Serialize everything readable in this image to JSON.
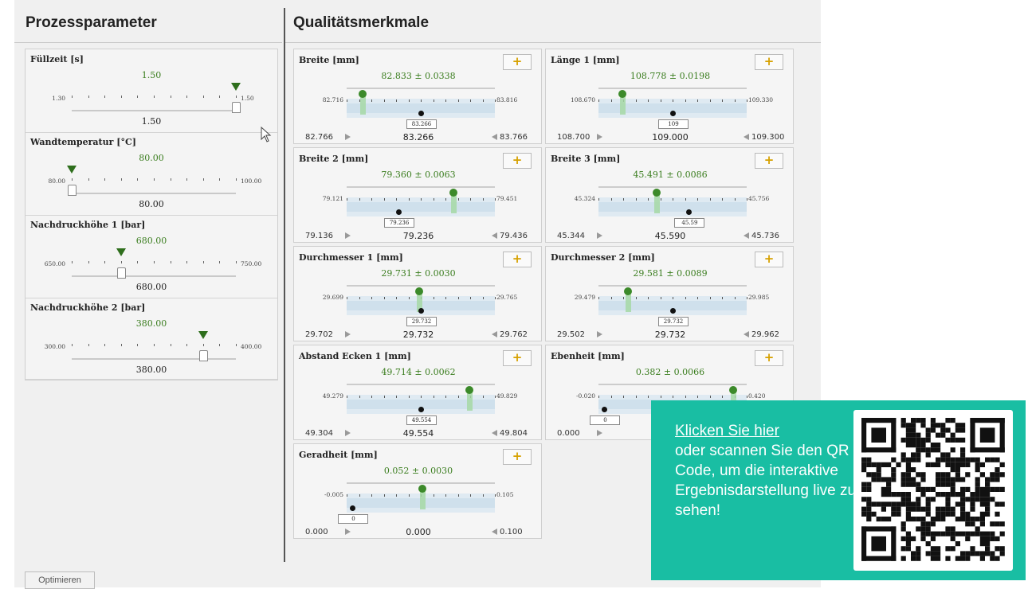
{
  "left_title": "Prozessparameter",
  "right_title": "Qualitätsmerkmale",
  "params": [
    {
      "label": "Füllzeit [s]",
      "value": "1.50",
      "min": "1.30",
      "max": "1.50",
      "current": "1.50",
      "fraction": 1.0
    },
    {
      "label": "Wandtemperatur [°C]",
      "value": "80.00",
      "min": "80.00",
      "max": "100.00",
      "current": "80.00",
      "fraction": 0.0
    },
    {
      "label": "Nachdruckhöhe 1 [bar]",
      "value": "680.00",
      "min": "650.00",
      "max": "750.00",
      "current": "680.00",
      "fraction": 0.3
    },
    {
      "label": "Nachdruckhöhe 2 [bar]",
      "value": "380.00",
      "min": "300.00",
      "max": "400.00",
      "current": "380.00",
      "fraction": 0.8
    }
  ],
  "qualities": [
    {
      "label": "Breite [mm]",
      "mean": "82.833 ± 0.0338",
      "axis_min": "82.716",
      "axis_max": "83.816",
      "box": "83.266",
      "low": "82.766",
      "center": "83.266",
      "high": "83.766",
      "green_frac": 0.11,
      "black_frac": 0.5
    },
    {
      "label": "Länge 1 [mm]",
      "mean": "108.778 ± 0.0198",
      "axis_min": "108.670",
      "axis_max": "109.330",
      "box": "109",
      "low": "108.700",
      "center": "109.000",
      "high": "109.300",
      "green_frac": 0.16,
      "black_frac": 0.5
    },
    {
      "label": "Breite 2 [mm]",
      "mean": "79.360 ± 0.0063",
      "axis_min": "79.121",
      "axis_max": "79.451",
      "box": "79.236",
      "low": "79.136",
      "center": "79.236",
      "high": "79.436",
      "green_frac": 0.72,
      "black_frac": 0.35
    },
    {
      "label": "Breite 3 [mm]",
      "mean": "45.491 ± 0.0086",
      "axis_min": "45.324",
      "axis_max": "45.756",
      "box": "45.59",
      "low": "45.344",
      "center": "45.590",
      "high": "45.736",
      "green_frac": 0.39,
      "black_frac": 0.61
    },
    {
      "label": "Durchmesser 1 [mm]",
      "mean": "29.731 ± 0.0030",
      "axis_min": "29.699",
      "axis_max": "29.765",
      "box": "29.732",
      "low": "29.702",
      "center": "29.732",
      "high": "29.762",
      "green_frac": 0.49,
      "black_frac": 0.5
    },
    {
      "label": "Durchmesser 2 [mm]",
      "mean": "29.581 ± 0.0089",
      "axis_min": "29.479",
      "axis_max": "29.985",
      "box": "29.732",
      "low": "29.502",
      "center": "29.732",
      "high": "29.962",
      "green_frac": 0.2,
      "black_frac": 0.5
    },
    {
      "label": "Abstand Ecken 1 [mm]",
      "mean": "49.714 ± 0.0062",
      "axis_min": "49.279",
      "axis_max": "49.829",
      "box": "49.554",
      "low": "49.304",
      "center": "49.554",
      "high": "49.804",
      "green_frac": 0.83,
      "black_frac": 0.5
    },
    {
      "label": "Ebenheit [mm]",
      "mean": "0.382 ± 0.0066",
      "axis_min": "-0.020",
      "axis_max": "0.420",
      "box": "0",
      "low": "0.000",
      "center": "",
      "high": "",
      "green_frac": 0.91,
      "black_frac": 0.04
    },
    {
      "label": "Geradheit [mm]",
      "mean": "0.052 ± 0.0030",
      "axis_min": "-0.005",
      "axis_max": "0.105",
      "box": "0",
      "low": "0.000",
      "center": "0.000",
      "high": "0.100",
      "green_frac": 0.51,
      "black_frac": 0.04
    }
  ],
  "plus_symbol": "+",
  "optimize_label": "Optimieren",
  "overlay": {
    "link_text": "Klicken Sie hier",
    "text": "oder scannen Sie den QR Code, um die interaktive Ergebnisdarstellung live zu sehen!"
  },
  "colors": {
    "accent_green": "#3c8a2a",
    "overlay_bg": "#19bea3",
    "plus_color": "#d6a100"
  }
}
